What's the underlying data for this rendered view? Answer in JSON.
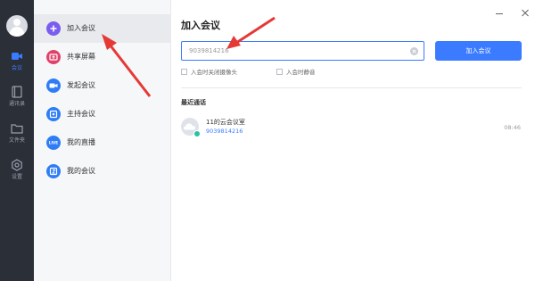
{
  "rail": {
    "items": [
      {
        "label": "会议",
        "icon": "video-camera-icon"
      },
      {
        "label": "通讯录",
        "icon": "contacts-icon"
      },
      {
        "label": "文件夹",
        "icon": "folder-icon"
      },
      {
        "label": "设置",
        "icon": "gear-icon"
      }
    ]
  },
  "menu": {
    "items": [
      {
        "label": "加入会议",
        "icon": "plus-icon"
      },
      {
        "label": "共享屏幕",
        "icon": "share-screen-icon"
      },
      {
        "label": "发起会议",
        "icon": "video-camera-icon"
      },
      {
        "label": "主持会议",
        "icon": "host-icon"
      },
      {
        "label": "我的直播",
        "icon": "live-icon",
        "icon_text": "LIVE"
      },
      {
        "label": "我的会议",
        "icon": "calendar-icon"
      }
    ]
  },
  "join": {
    "title": "加入会议",
    "meeting_id_value": "9039814216",
    "join_button": "加入会议",
    "options": [
      {
        "label": "入会时关闭摄像头",
        "checked": false
      },
      {
        "label": "入会时静音",
        "checked": false
      }
    ]
  },
  "recent": {
    "title": "最近通话",
    "items": [
      {
        "name": "11的云会议室",
        "id": "9039814216",
        "time": "08:46"
      }
    ]
  },
  "colors": {
    "accent": "#3a7bff",
    "rail_bg": "#2b2f38",
    "annotation": "#e53935"
  }
}
